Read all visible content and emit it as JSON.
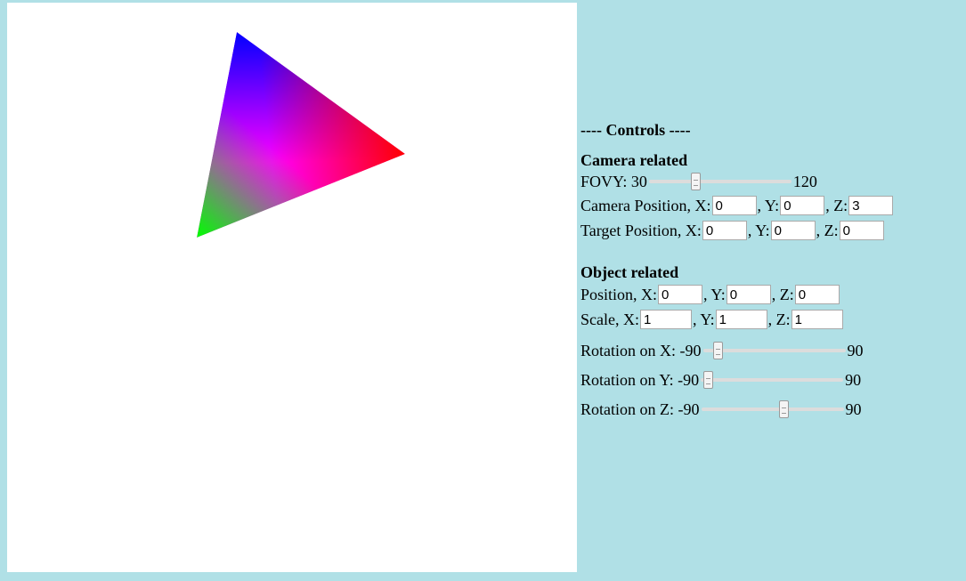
{
  "viewport": {
    "triangle": {
      "vertex_colors": [
        "#0000ff",
        "#ff0000",
        "#00ff00"
      ],
      "center_color": "#ff00ff"
    },
    "background": "#ffffff"
  },
  "page_background": "#b0e0e6",
  "controls": {
    "title": "---- Controls ----",
    "camera": {
      "heading": "Camera related",
      "fovy": {
        "label": "FOVY: 30",
        "max_label": "120",
        "min": 30,
        "max": 120,
        "value": 60
      },
      "camera_position": {
        "label_x": "Camera Position, X:",
        "label_y": ", Y:",
        "label_z": ", Z:",
        "x": "0",
        "y": "0",
        "z": "3"
      },
      "target_position": {
        "label_x": "Target Position, X:",
        "label_y": ", Y:",
        "label_z": ", Z:",
        "x": "0",
        "y": "0",
        "z": "0"
      }
    },
    "object": {
      "heading": "Object related",
      "position": {
        "label_x": "Position, X:",
        "label_y": ", Y:",
        "label_z": ", Z:",
        "x": "0",
        "y": "0",
        "z": "0"
      },
      "scale": {
        "label_x": "Scale, X:",
        "label_y": ", Y:",
        "label_z": ", Z:",
        "x": "1",
        "y": "1",
        "z": "1"
      },
      "rotation_x": {
        "label": "Rotation on X: -90",
        "max_label": "90",
        "min": -90,
        "max": 90,
        "value": -70
      },
      "rotation_y": {
        "label": "Rotation on Y: -90",
        "max_label": "90",
        "min": -90,
        "max": 90,
        "value": -80
      },
      "rotation_z": {
        "label": "Rotation on Z: -90",
        "max_label": "90",
        "min": -90,
        "max": 90,
        "value": 15
      }
    }
  }
}
